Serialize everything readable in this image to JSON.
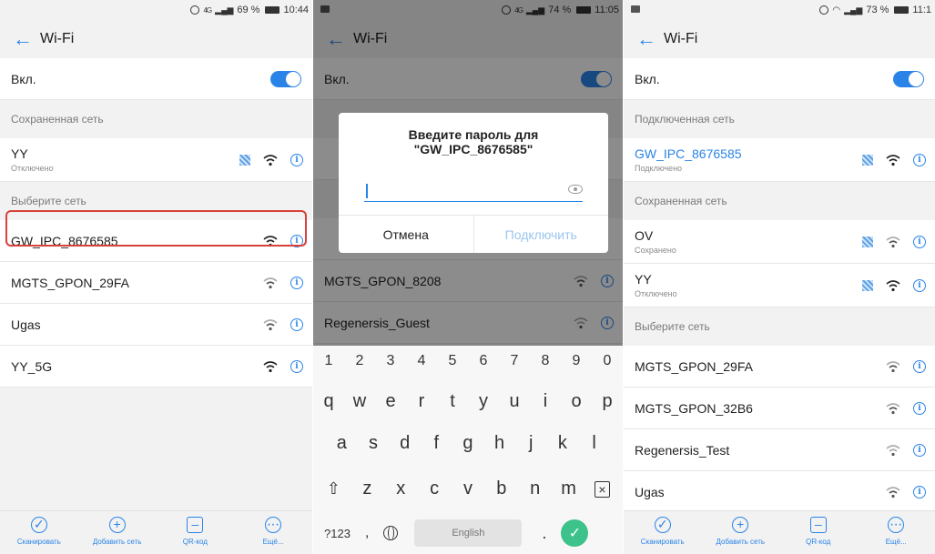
{
  "screens": [
    {
      "status": {
        "time": "10:44",
        "battery": "69 %",
        "signal": "4G"
      },
      "title": "Wi-Fi",
      "toggle_label": "Вкл.",
      "saved_section": "Сохраненная сеть",
      "saved": [
        {
          "name": "YY",
          "status": "Отключено"
        }
      ],
      "choose_section": "Выберите сеть",
      "networks": [
        {
          "name": "GW_IPC_8676585"
        },
        {
          "name": "MGTS_GPON_29FA"
        },
        {
          "name": "Ugas"
        },
        {
          "name": "YY_5G"
        }
      ],
      "bottom": [
        "Сканировать",
        "Добавить сеть",
        "QR-код",
        "Ещё..."
      ]
    },
    {
      "status": {
        "time": "11:05",
        "battery": "74 %",
        "signal": "4G"
      },
      "title": "Wi-Fi",
      "toggle_label": "Вкл.",
      "networks": [
        {
          "name": "MGTS_GPON_8208"
        },
        {
          "name": "Regenersis_Guest"
        }
      ],
      "dialog": {
        "title_line1": "Введите пароль для",
        "title_line2": "\"GW_IPC_8676585\"",
        "cancel": "Отмена",
        "connect": "Подключить"
      },
      "keyboard": {
        "numbers": [
          "1",
          "2",
          "3",
          "4",
          "5",
          "6",
          "7",
          "8",
          "9",
          "0"
        ],
        "row1": [
          "q",
          "w",
          "e",
          "r",
          "t",
          "y",
          "u",
          "i",
          "o",
          "p"
        ],
        "row2": [
          "a",
          "s",
          "d",
          "f",
          "g",
          "h",
          "j",
          "k",
          "l"
        ],
        "row3": [
          "z",
          "x",
          "c",
          "v",
          "b",
          "n",
          "m"
        ],
        "symbols": "?123",
        "comma": ",",
        "space": "English",
        "period": "."
      }
    },
    {
      "status": {
        "time": "11:1",
        "battery": "73 %"
      },
      "title": "Wi-Fi",
      "toggle_label": "Вкл.",
      "connected_section": "Подключенная сеть",
      "connected": {
        "name": "GW_IPC_8676585",
        "status": "Подключено"
      },
      "saved_section": "Сохраненная сеть",
      "saved": [
        {
          "name": "OV",
          "status": "Сохранено"
        },
        {
          "name": "YY",
          "status": "Отключено"
        }
      ],
      "choose_section": "Выберите сеть",
      "networks": [
        {
          "name": "MGTS_GPON_29FA"
        },
        {
          "name": "MGTS_GPON_32B6"
        },
        {
          "name": "Regenersis_Test"
        },
        {
          "name": "Ugas"
        }
      ],
      "bottom": [
        "Сканировать",
        "Добавить сеть",
        "QR-код",
        "Ещё..."
      ]
    }
  ],
  "colors": {
    "accent": "#2a84e8",
    "highlight": "#d9403a",
    "enter": "#3cc28a"
  }
}
